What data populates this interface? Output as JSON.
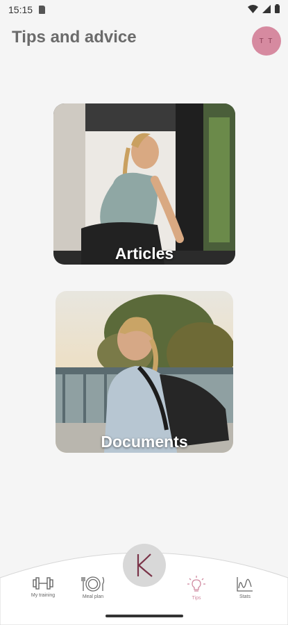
{
  "status_bar": {
    "time": "15:15"
  },
  "header": {
    "title": "Tips and advice",
    "avatar_initials": "T T"
  },
  "cards": [
    {
      "label": "Articles"
    },
    {
      "label": "Documents"
    }
  ],
  "nav": {
    "center_logo": "K",
    "items": [
      {
        "label": "My training",
        "icon": "dumbbell-icon"
      },
      {
        "label": "Meal plan",
        "icon": "plate-cutlery-icon"
      },
      {
        "label": "Tips",
        "icon": "lightbulb-icon",
        "active": true
      },
      {
        "label": "Stats",
        "icon": "chart-icon"
      }
    ],
    "active_color": "#d08aa0"
  }
}
